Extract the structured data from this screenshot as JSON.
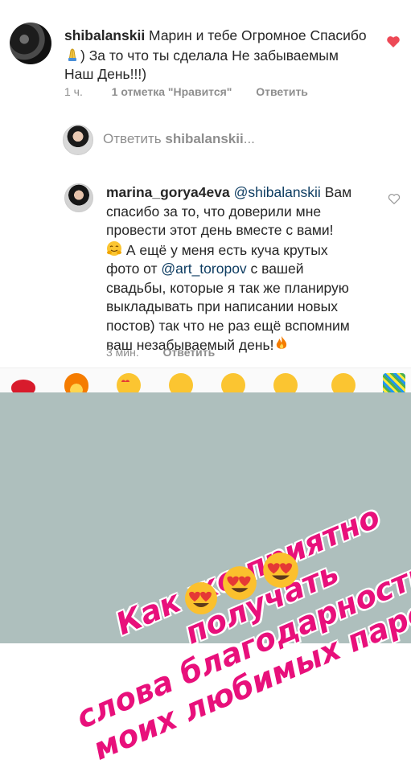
{
  "comment1": {
    "username": "shibalanskii",
    "line1_text": " Марин и тебе Огромное Спасибо",
    "line2_text": ") За то что ты сделала Не забываемым",
    "line3_text": "Наш День!!!)",
    "time": "1 ч.",
    "likes": "1 отметка \"Нравится\"",
    "reply": "Ответить"
  },
  "reply_input": {
    "prefix": "Ответить ",
    "username": "shibalanskii",
    "suffix": "..."
  },
  "comment2": {
    "username": "marina_gorya4eva",
    "mention1": "@shibalanskii",
    "line1_tail": " Вам",
    "line2": "спасибо за то, что доверили мне",
    "line3": "провести этот день вместе с вами!",
    "line4": " А ещё у меня есть куча крутых",
    "line5_pre": "фото от ",
    "mention2": "@art_toropov",
    "line5_post": " с вашей",
    "line6": "свадьбы, которые я так же планирую",
    "line7": "выкладывать при написании новых",
    "line8": "постов) так что не раз ещё вспомним",
    "line9": "ваш незабываемый день!",
    "time": "3 мин.",
    "reply": "Ответить"
  },
  "emoji_bar": {
    "items": [
      "lips",
      "fire",
      "heart-eyes",
      "smirk",
      "rofl",
      "crying",
      "wink",
      "confetti"
    ]
  },
  "sticker": {
    "line1": "Как же приятно получать",
    "line2": "слова благодарности от",
    "line3": "моих любимых парочек",
    "color": "#e8107b"
  },
  "colors": {
    "background": "#ffffff",
    "sticker_background": "#aebfbd",
    "heart_liked": "#ed4956",
    "mention": "#0d3c61",
    "meta": "#8e8e8e"
  }
}
